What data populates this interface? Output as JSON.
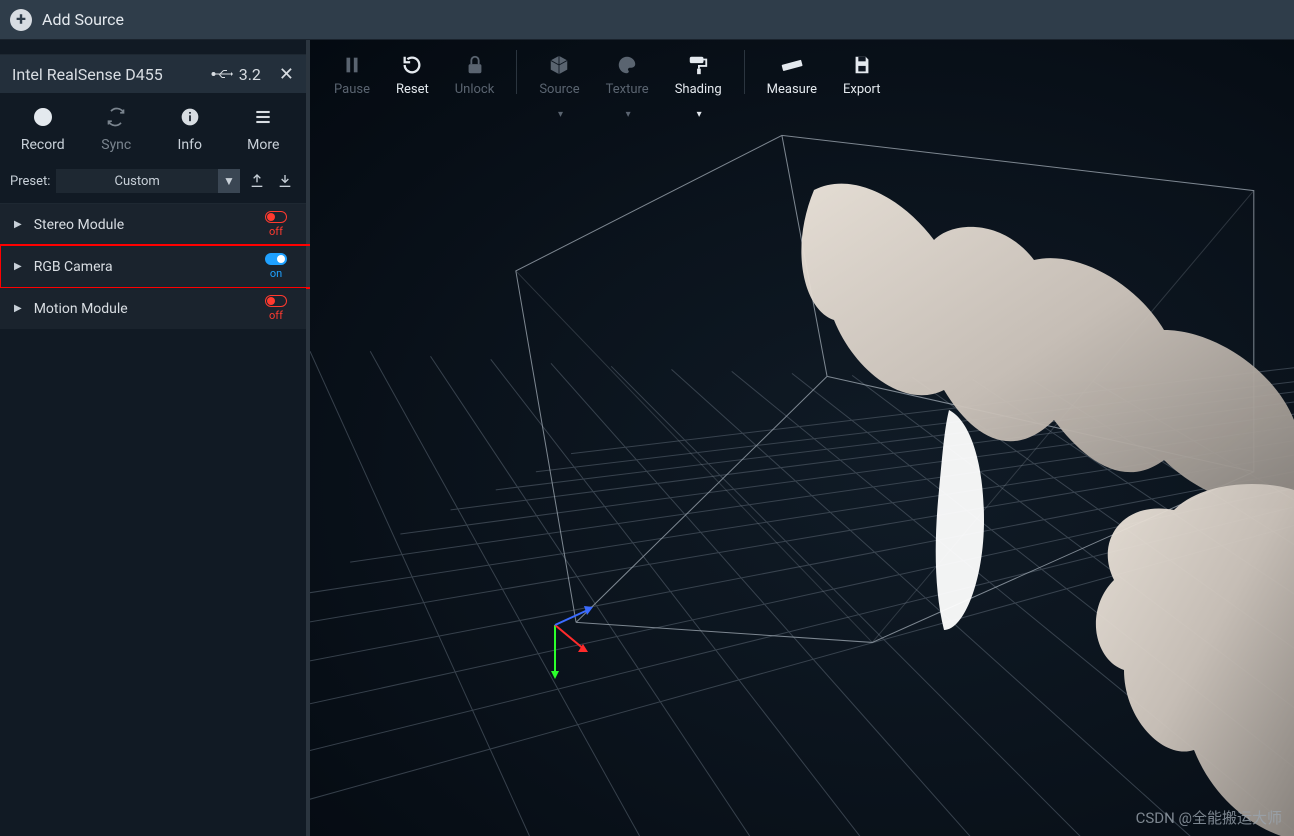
{
  "topbar": {
    "add_source": "Add Source"
  },
  "device": {
    "name": "Intel RealSense D455",
    "usb_version": "3.2"
  },
  "actions": {
    "record": "Record",
    "sync": "Sync",
    "info": "Info",
    "more": "More"
  },
  "preset": {
    "label": "Preset:",
    "value": "Custom"
  },
  "modules": [
    {
      "name": "Stereo Module",
      "state": "off",
      "state_label": "off"
    },
    {
      "name": "RGB Camera",
      "state": "on",
      "state_label": "on"
    },
    {
      "name": "Motion Module",
      "state": "off",
      "state_label": "off"
    }
  ],
  "toolbar": {
    "pause": "Pause",
    "reset": "Reset",
    "unlock": "Unlock",
    "source": "Source",
    "texture": "Texture",
    "shading": "Shading",
    "measure": "Measure",
    "export": "Export"
  },
  "watermark": "CSDN @全能搬运大师"
}
